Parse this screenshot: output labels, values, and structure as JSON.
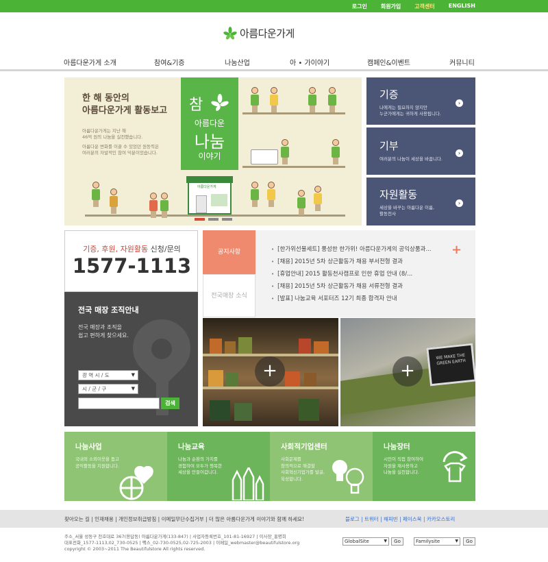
{
  "topbar": {
    "links": [
      "로그인",
      "회원가입",
      "고객센터",
      "ENGLISH"
    ]
  },
  "logo": {
    "text": "아름다운가게"
  },
  "nav": {
    "items": [
      "아름다운가게 소개",
      "참여&기증",
      "나눔산업",
      "아 • 가이야기",
      "캠페인&이벤트",
      "커뮤니티"
    ]
  },
  "hero": {
    "title_line1": "한 해 동안의",
    "title_line2": "아름다운가게 활동보고",
    "desc_line1": "아름다운가게는 지난 해",
    "desc_line2": "46억 원의 나눔을 실천했습니다.",
    "desc_line3": "아름다운 변화를 이끌 수 있었던 원동력은",
    "desc_line4": "여러분의 자발적인 참여 덕분이었습니다.",
    "badge_a": "참",
    "badge_b": "아름다운",
    "badge_c": "나눔",
    "badge_d": "이야기",
    "store_sign": "아름다운가게"
  },
  "side_menu": [
    {
      "title": "기증",
      "sub1": "나에게는 필요하지 않지만",
      "sub2": "누군가에게는 귀하게 사용됩니다."
    },
    {
      "title": "기부",
      "sub1": "여러분의 나눔이 세상을 바꿉니다.",
      "sub2": ""
    },
    {
      "title": "자원활동",
      "sub1": "세상을 바꾸는 아름다운 이름,",
      "sub2": "활동천사"
    }
  ],
  "contact": {
    "q_red": "기증, 후원, 자원활동",
    "q_rest": " 신청/문의",
    "phone": "1577-1113"
  },
  "finder": {
    "title": "전국 매장 조직안내",
    "desc1": "전국 매장과 조직을",
    "desc2": "쉽고 편하게 찾으세요.",
    "select1": "광 역 시 / 도",
    "select2": "시 / 군 / 구",
    "search_btn": "검색"
  },
  "notice": {
    "tab1": "공지사항",
    "tab2": "전국매장 소식",
    "items": [
      "[한가위선물세트] 풍성한 한가위! 아름다운가게의 공익상품과...",
      "[채용] 2015년 5차 상근활동가 채용 부서전형 결과",
      "[휴업안내] 2015 활동천사캠프로 인한 휴업 안내 (8/...",
      "[채용] 2015년 5차 상근활동가 채용 서류전형 결과",
      "[발표] 나눔교육 서포터즈 12기 최종 합격자 안내"
    ]
  },
  "photo2_frame": "WE MAKE THE GREEN EARTH",
  "green_boxes": [
    {
      "title": "나눔사업",
      "d1": "국내외 소외이웃을 돕고",
      "d2": "공익활동을 지원합니다.",
      "d3": "",
      "color": "#8fc475"
    },
    {
      "title": "나눔교육",
      "d1": "나눔과 순환의 가치를",
      "d2": "경험하여 모두가 행복한",
      "d3": "세상을 만들어갑니다.",
      "color": "#6db55a"
    },
    {
      "title": "사회적기업센터",
      "d1": "사회문제를",
      "d2": "창의적으로 해결할",
      "d3": "사회혁신기업가를 발굴, 육성합니다.",
      "color": "#8fc475"
    },
    {
      "title": "나눔장터",
      "d1": "시민이 직접 참여하여",
      "d2": "자원을 재사용하고",
      "d3": "나눔을 실천합니다.",
      "color": "#6db55a"
    }
  ],
  "footer": {
    "links": "찾아오는 길  |  인재채용  |  개인정보취급방침  |  이메일무단수집거부  |  더 많은 아름다운가게 이야기와 함께 하세요!",
    "social": "블로그  |  트위터  |  해피빈  |  페이스북  |  카카오스토리",
    "info1": "주소_서울 성동구 천호대로 367(용답동) 아름다운가게(133-847)  |  사업자등록번호_101-81-16927  |  이사장_홍명희",
    "info2": "대표전화_1577-1113,02_730-0525  |  팩스_02-730-0525,02-725-2003  |  이메일_webmaster@beautifulstore.org",
    "info3": "copyright © 2003~2011 The Beautifulstore All rights reserved.",
    "select1": "GlobalSite",
    "select2": "Familysite",
    "go": "Go"
  },
  "colors": {
    "brand_green": "#4bb336",
    "navy": "#4b5575",
    "accent_red": "#d24234",
    "coral": "#ef8a6e"
  }
}
